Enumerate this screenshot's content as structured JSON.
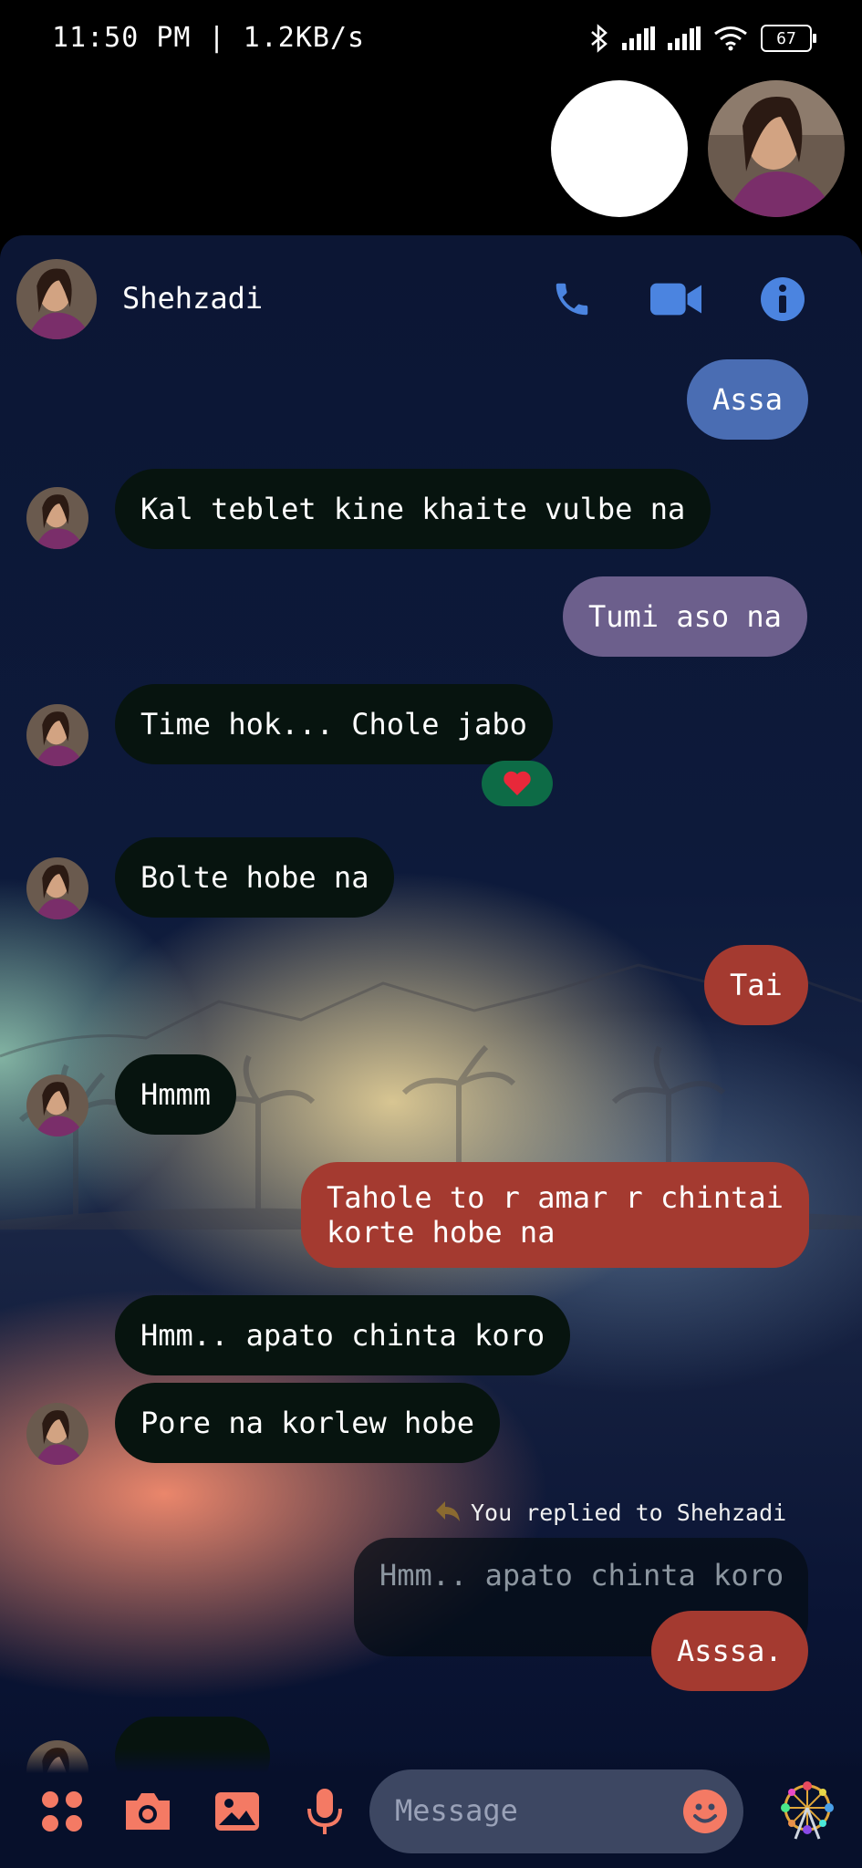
{
  "status_bar": {
    "time_speed": "11:50 PM | 1.2KB/s",
    "battery": "67",
    "icons": [
      "bluetooth-icon",
      "signal-icon",
      "signal-icon",
      "wifi-icon",
      "battery-icon"
    ]
  },
  "chat": {
    "contact_name": "Shehzadi",
    "header_icons": [
      "phone-icon",
      "video-call-icon",
      "info-icon"
    ],
    "messages": [
      {
        "text": "Assa",
        "direction": "out",
        "color": "#4a6db3"
      },
      {
        "text": "Kal teblet kine khaite vulbe na",
        "direction": "in"
      },
      {
        "text": "Tumi aso na",
        "direction": "out",
        "color": "#6c5f8c"
      },
      {
        "text": "Time hok... Chole jabo",
        "direction": "in",
        "reaction": "heart"
      },
      {
        "text": "Bolte hobe na",
        "direction": "in"
      },
      {
        "text": "Tai",
        "direction": "out",
        "color": "#a43a30"
      },
      {
        "text": "Hmmm",
        "direction": "in"
      },
      {
        "text": "Tahole to r amar r chintai\nkorte hobe na",
        "direction": "out",
        "color": "#a43a30"
      },
      {
        "text": "Hmm.. apato chinta koro",
        "direction": "in"
      },
      {
        "text": "Pore na korlew hobe",
        "direction": "in"
      },
      {
        "text": "Asssa.",
        "direction": "out",
        "color": "#a43a30"
      }
    ],
    "reply_label": "You replied to Shehzadi",
    "quoted_text": "Hmm.. apato chinta koro"
  },
  "composer": {
    "placeholder": "Message",
    "icons": [
      "apps-icon",
      "camera-icon",
      "gallery-icon",
      "microphone-icon",
      "emoji-icon",
      "ferris-wheel-icon"
    ],
    "accent": "#f47a64"
  }
}
